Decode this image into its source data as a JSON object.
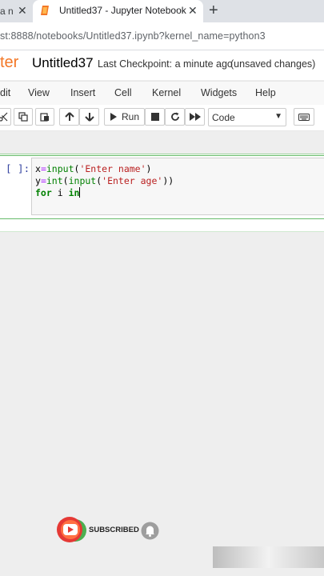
{
  "browser": {
    "prev_tab": {
      "title": "a n",
      "close": "✕"
    },
    "active_tab": {
      "title": "Untitled37 - Jupyter Notebook",
      "close": "✕"
    },
    "new_tab": "+",
    "address": "st:8888/notebooks/Untitled37.ipynb?kernel_name=python3"
  },
  "header": {
    "logo_text": "ter",
    "notebook_title": "Untitled37",
    "checkpoint": "Last Checkpoint: a minute ago",
    "unsaved": "(unsaved changes)"
  },
  "menubar": {
    "items": [
      "dit",
      "View",
      "Insert",
      "Cell",
      "Kernel",
      "Widgets",
      "Help"
    ]
  },
  "toolbar": {
    "run_label": "Run",
    "cell_type": "Code"
  },
  "cell": {
    "prompt": "[ ]:",
    "lines": [
      {
        "a": "x",
        "b": "=",
        "c": "input",
        "d": "(",
        "e": "'Enter name'",
        "f": ")"
      },
      {
        "a": "y",
        "b": "=",
        "c": "int",
        "d": "(",
        "g": "input",
        "h": "(",
        "e": "'Enter age'",
        "f": "))"
      },
      {
        "k1": "for",
        "v": " i ",
        "k2": "in"
      }
    ]
  },
  "overlay": {
    "subscribed": "SUBSCRIBED"
  },
  "colors": {
    "jupyter_orange": "#f37726",
    "cell_border": "#66bb6a",
    "prompt_blue": "#303f9f",
    "keyword_green": "#008000",
    "string_red": "#ba2121",
    "youtube_red": "#ff0000"
  }
}
